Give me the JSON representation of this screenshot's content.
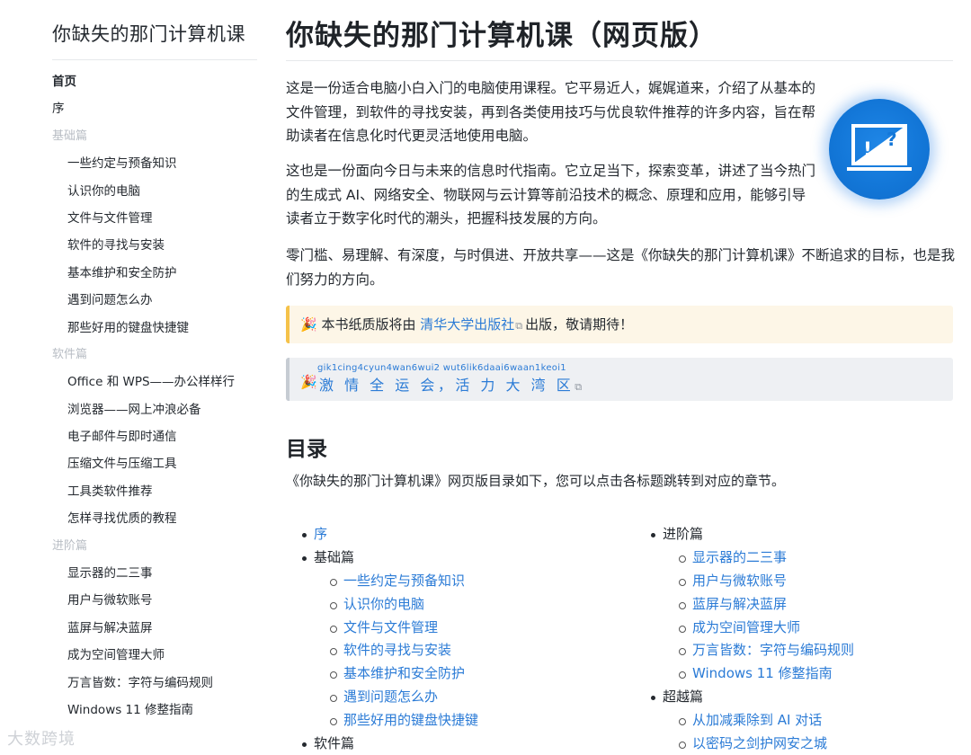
{
  "sidebar": {
    "site_title": "你缺失的那门计算机课",
    "items": [
      {
        "label": "首页",
        "kind": "bold"
      },
      {
        "label": "序",
        "kind": "item"
      },
      {
        "label": "基础篇",
        "kind": "section"
      },
      {
        "label": "一些约定与预备知识",
        "kind": "sub"
      },
      {
        "label": "认识你的电脑",
        "kind": "sub"
      },
      {
        "label": "文件与文件管理",
        "kind": "sub"
      },
      {
        "label": "软件的寻找与安装",
        "kind": "sub"
      },
      {
        "label": "基本维护和安全防护",
        "kind": "sub"
      },
      {
        "label": "遇到问题怎么办",
        "kind": "sub"
      },
      {
        "label": "那些好用的键盘快捷键",
        "kind": "sub"
      },
      {
        "label": "软件篇",
        "kind": "section"
      },
      {
        "label": "Office 和 WPS——办公样样行",
        "kind": "sub"
      },
      {
        "label": "浏览器——网上冲浪必备",
        "kind": "sub"
      },
      {
        "label": "电子邮件与即时通信",
        "kind": "sub"
      },
      {
        "label": "压缩文件与压缩工具",
        "kind": "sub"
      },
      {
        "label": "工具类软件推荐",
        "kind": "sub"
      },
      {
        "label": "怎样寻找优质的教程",
        "kind": "sub"
      },
      {
        "label": "进阶篇",
        "kind": "section"
      },
      {
        "label": "显示器的二三事",
        "kind": "sub"
      },
      {
        "label": "用户与微软账号",
        "kind": "sub"
      },
      {
        "label": "蓝屏与解决蓝屏",
        "kind": "sub"
      },
      {
        "label": "成为空间管理大师",
        "kind": "sub"
      },
      {
        "label": "万言皆数：字符与编码规则",
        "kind": "sub"
      },
      {
        "label": "Windows 11 修整指南",
        "kind": "sub"
      }
    ]
  },
  "main": {
    "title": "你缺失的那门计算机课（网页版）",
    "paragraphs": [
      "这是一份适合电脑小白入门的电脑使用课程。它平易近人，娓娓道来，介绍了从基本的文件管理，到软件的寻找安装，再到各类使用技巧与优良软件推荐的许多内容，旨在帮助读者在信息化时代更灵活地使用电脑。",
      "这也是一份面向今日与未来的信息时代指南。它立足当下，探索变革，讲述了当今热门的生成式 AI、网络安全、物联网与云计算等前沿技术的概念、原理和应用，能够引导读者立于数字化时代的潮头，把握科技发展的方向。",
      "零门槛、易理解、有深度，与时俱进、开放共享——这是《你缺失的那门计算机课》不断追求的目标，也是我们努力的方向。"
    ],
    "tip": {
      "emoji": "🎉",
      "prefix": "本书纸质版将由",
      "link": "清华大学出版社",
      "suffix": "出版，敬请期待！"
    },
    "banner": {
      "emoji": "🎉",
      "ruby": "gik1cing4cyun4wan6wui2  wut6lik6daai6waan1keoi1",
      "text": "激 情 全 运 会，活 力 大 湾 区"
    },
    "toc_heading": "目录",
    "toc_desc": "《你缺失的那门计算机课》网页版目录如下，您可以点击各标题跳转到对应的章节。",
    "toc_left": [
      {
        "label": "序",
        "kind": "toplink"
      },
      {
        "label": "基础篇",
        "kind": "top"
      },
      {
        "label": "一些约定与预备知识",
        "kind": "child"
      },
      {
        "label": "认识你的电脑",
        "kind": "child"
      },
      {
        "label": "文件与文件管理",
        "kind": "child"
      },
      {
        "label": "软件的寻找与安装",
        "kind": "child"
      },
      {
        "label": "基本维护和安全防护",
        "kind": "child"
      },
      {
        "label": "遇到问题怎么办",
        "kind": "child"
      },
      {
        "label": "那些好用的键盘快捷键",
        "kind": "child"
      },
      {
        "label": "软件篇",
        "kind": "top"
      }
    ],
    "toc_right": [
      {
        "label": "进阶篇",
        "kind": "top"
      },
      {
        "label": "显示器的二三事",
        "kind": "child"
      },
      {
        "label": "用户与微软账号",
        "kind": "child"
      },
      {
        "label": "蓝屏与解决蓝屏",
        "kind": "child"
      },
      {
        "label": "成为空间管理大师",
        "kind": "child"
      },
      {
        "label": "万言皆数：字符与编码规则",
        "kind": "child"
      },
      {
        "label": "Windows 11 修整指南",
        "kind": "child"
      },
      {
        "label": "超越篇",
        "kind": "top"
      },
      {
        "label": "从加减乘除到 AI 对话",
        "kind": "child"
      },
      {
        "label": "以密码之剑护网安之城",
        "kind": "child"
      }
    ]
  },
  "logo_icon": "laptop-question-icon",
  "watermark": "大数跨境",
  "colors": {
    "link": "#2b7bd6",
    "tip_bg": "#fdf6e7",
    "tip_border": "#f5c24a",
    "logo_blue": "#1377d8"
  }
}
